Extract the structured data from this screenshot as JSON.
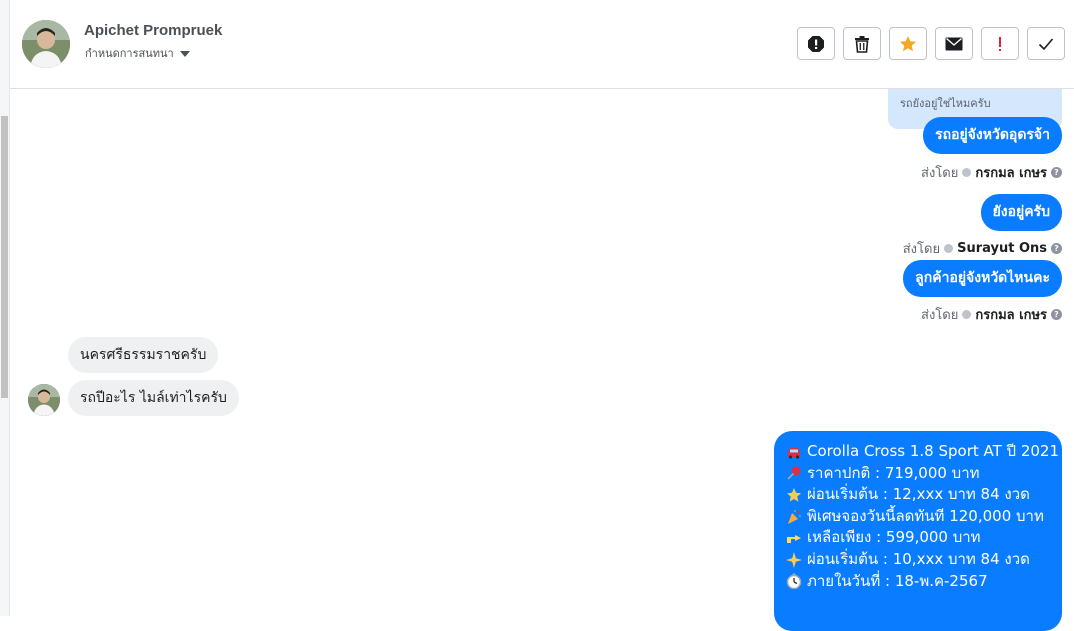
{
  "header": {
    "user_name": "Apichet Prompruek",
    "assign_label": "กำหนดการสนทนา",
    "actions": [
      {
        "name": "spam-icon",
        "label": "!"
      },
      {
        "name": "trash-icon",
        "label": ""
      },
      {
        "name": "star-icon",
        "label": ""
      },
      {
        "name": "mail-icon",
        "label": ""
      },
      {
        "name": "exclamation-icon",
        "label": "!"
      },
      {
        "name": "check-icon",
        "label": ""
      }
    ]
  },
  "messages": {
    "reply_preview": "รถยังอยู่ใช่ไหมครับ",
    "m1": "รถอยู่จังหวัดอุดรจ้า",
    "m1_sent_prefix": "ส่งโดย",
    "m1_agent": "กรกมล เกษร",
    "m2": "ยังอยู่ครับ",
    "m2_sent_prefix": "ส่งโดย",
    "m2_agent": "Surayut Ons",
    "m3": "ลูกค้าอยู่จังหวัดไหนคะ",
    "m3_sent_prefix": "ส่งโดย",
    "m3_agent": "กรกมล เกษร",
    "in1": "นครศรีธรรมราชครับ",
    "in2": "รถปีอะไร ไมล์เท่าไรครับ",
    "help_glyph": "?"
  },
  "listing": {
    "line1": "Corolla Cross 1.8 Sport AT ปี 2021",
    "line2": "ราคาปกติ : 719,000 บาท",
    "line3": "ผ่อนเริ่มต้น : 12,xxx บาท 84 งวด",
    "line4": "พิเศษจองวันนี้ลดทันที 120,000 บาท",
    "line5": "เหลือเพียง : 599,000 บาท",
    "line6": "ผ่อนเริ่มต้น : 10,xxx บาท 84 งวด",
    "line7": "ภายในวันที่ : 18-พ.ค-2567",
    "icons": [
      "car-icon",
      "pushpin-icon",
      "star-icon",
      "party-icon",
      "point-right-icon",
      "sparkle-icon",
      "clock-icon"
    ]
  },
  "colors": {
    "accent": "#0a7cff",
    "incoming_bubble": "#eff0f2",
    "reply_preview_bg": "#d4e7fd",
    "star": "#f5a623",
    "alert_red": "#e41e3f"
  }
}
